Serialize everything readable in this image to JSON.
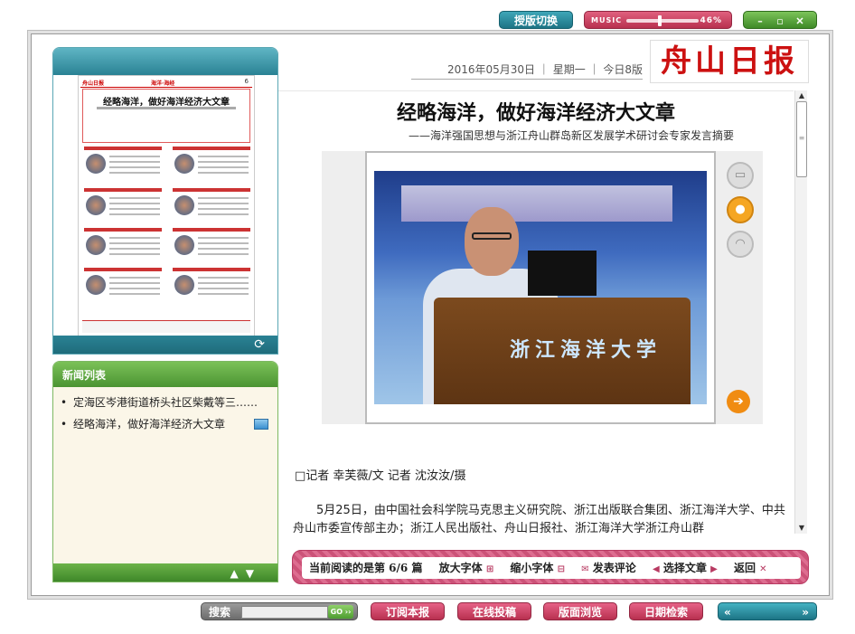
{
  "top": {
    "layout_switch": "授版切换",
    "music_label": "MUSIC",
    "music_volume": "46%",
    "music_volume_fraction": 0.46,
    "min_symbol": "–",
    "restore_symbol": "▫",
    "close_symbol": "✕"
  },
  "masthead": {
    "logo": "舟山日报",
    "date": "2016年05月30日",
    "weekday": "星期一",
    "edition": "今日8版"
  },
  "thumbnail": {
    "masthead": "舟山日报",
    "section": "海洋·海经",
    "page": "6",
    "headline": "经略海洋，做好海洋经济大文章"
  },
  "news_list": {
    "title": "新闻列表",
    "items": [
      {
        "label": "定海区岑港街道桥头社区柴戴等三……",
        "has_image": false
      },
      {
        "label": "经略海洋，做好海洋经济大文章",
        "has_image": true
      }
    ]
  },
  "article": {
    "title": "经略海洋，做好海洋经济大文章",
    "subtitle": "——海洋强国思想与浙江舟山群岛新区发展学术研讨会专家发言摘要",
    "photo_podium_text": "浙江海洋大学",
    "byline": "□记者 幸芙薇/文 记者 沈汝汝/摄",
    "body": "5月25日，由中国社会科学院马克思主义研究院、浙江出版联合集团、浙江海洋大学、中共舟山市委宣传部主办；浙江人民出版社、舟山日报社、浙江海洋大学浙江舟山群"
  },
  "reading_bar": {
    "current": "当前阅读的是第 6/6 篇",
    "enlarge": "放大字体",
    "shrink": "缩小字体",
    "comment": "发表评论",
    "choose": "选择文章",
    "back": "返回"
  },
  "bottom": {
    "search_label": "搜索",
    "go": "GO ››",
    "subscribe": "订阅本报",
    "submit": "在线投稿",
    "browse": "版面浏览",
    "date_search": "日期检索",
    "prev": "«",
    "next": "»"
  }
}
